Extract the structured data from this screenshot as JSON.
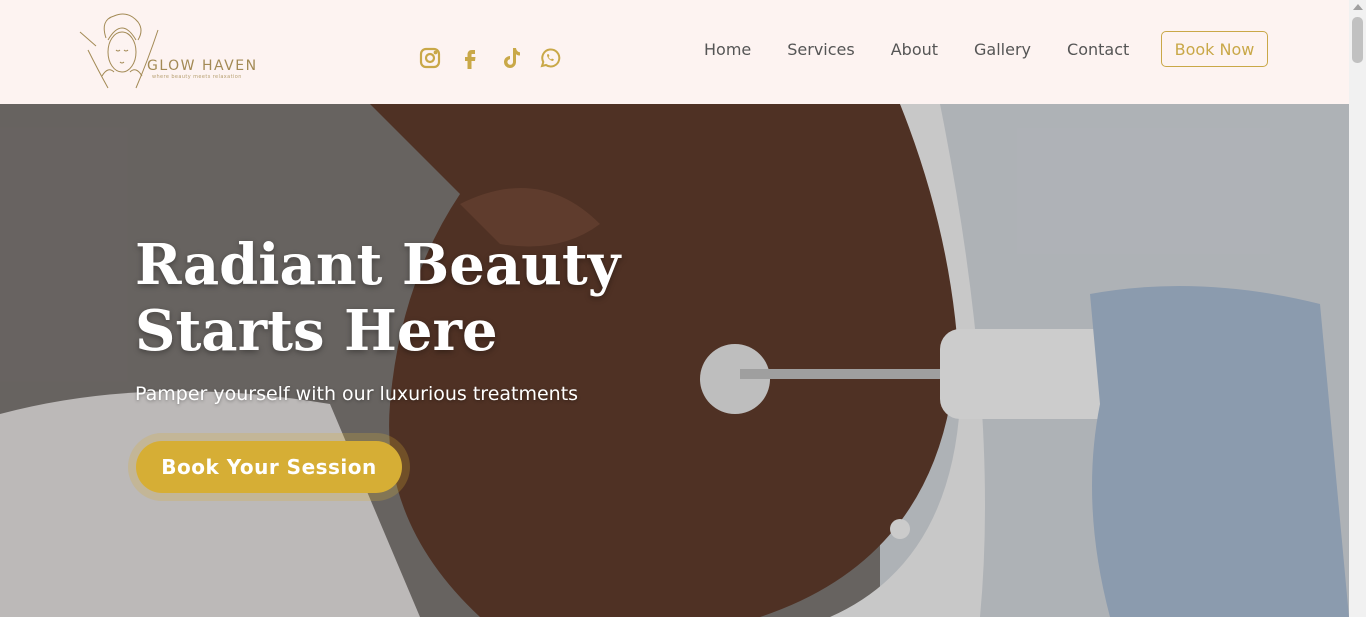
{
  "brand": {
    "name": "GLOW HAVEN",
    "tagline": "where beauty meets relaxation",
    "accent_color": "#c9a848"
  },
  "social": [
    {
      "icon": "instagram-icon"
    },
    {
      "icon": "facebook-icon"
    },
    {
      "icon": "tiktok-icon"
    },
    {
      "icon": "whatsapp-icon"
    }
  ],
  "nav": {
    "links": [
      "Home",
      "Services",
      "About",
      "Gallery",
      "Contact"
    ],
    "cta_label": "Book Now"
  },
  "hero": {
    "title": "Radiant Beauty Starts Here",
    "subtitle": "Pamper yourself with our luxurious treatments",
    "cta_label": "Book Your Session",
    "cta_color": "#d6ae35"
  }
}
